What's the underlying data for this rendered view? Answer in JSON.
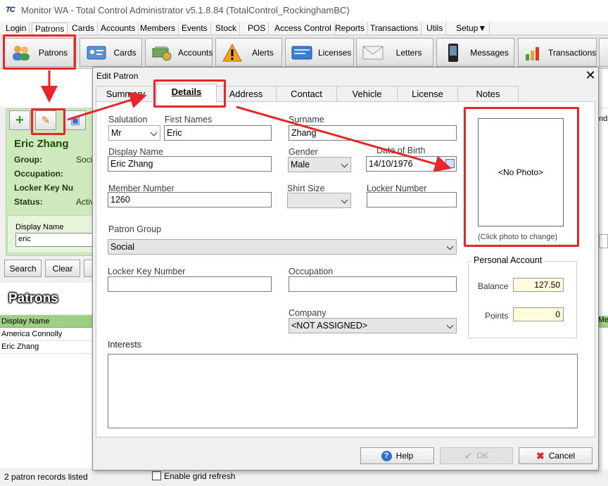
{
  "window": {
    "logo": "TC",
    "title": "Monitor WA - Total Control Administrator v5.1.8.84 (TotalControl_RockinghamBC)"
  },
  "menu": [
    "Login",
    "Patrons",
    "Cards",
    "Accounts",
    "Members",
    "Events",
    "Stock",
    "POS",
    "Access Control",
    "Reports",
    "Transactions",
    "Utils",
    "Setup"
  ],
  "toolbar": [
    {
      "label": "Patrons",
      "icon": "people-icon"
    },
    {
      "label": "Cards",
      "icon": "id-card-icon"
    },
    {
      "label": "Accounts",
      "icon": "money-icon"
    },
    {
      "label": "Alerts",
      "icon": "warning-icon"
    },
    {
      "label": "Licenses",
      "icon": "license-icon"
    },
    {
      "label": "Letters",
      "icon": "envelope-icon"
    },
    {
      "label": "Messages",
      "icon": "phone-icon"
    },
    {
      "label": "Transactions",
      "icon": "bar-chart-icon"
    }
  ],
  "background": {
    "patron_name": "Eric Zhang",
    "fields": [
      {
        "label": "Group:",
        "value": "Soci"
      },
      {
        "label": "Occupation:",
        "value": ""
      },
      {
        "label": "Locker Key Nu",
        "value": ""
      },
      {
        "label": "Status:",
        "value": "Activ"
      }
    ],
    "display_name_label": "Display Name",
    "display_name_value": "eric",
    "search_label": "Search",
    "clear_label": "Clear",
    "patrons_title": "Patrons",
    "grid_header": "Display Name",
    "rows": [
      "America Connolly",
      "Eric Zhang"
    ],
    "right_fragment_1": "nds",
    "right_fragment_2": "Men",
    "status": "2 patron records listed",
    "refresh_label": "Enable grid refresh"
  },
  "dialog": {
    "title": "Edit Patron",
    "close": "✕",
    "tabs": [
      "Summary",
      "Details",
      "Address",
      "Contact",
      "Vehicle",
      "License",
      "Notes"
    ],
    "active_tab": "Details",
    "salutation": {
      "label": "Salutation",
      "value": "Mr"
    },
    "first_names": {
      "label": "First Names",
      "value": "Eric"
    },
    "surname": {
      "label": "Surname",
      "value": "Zhang"
    },
    "display_name": {
      "label": "Display Name",
      "value": "Eric Zhang"
    },
    "gender": {
      "label": "Gender",
      "value": "Male"
    },
    "dob": {
      "label": "Date of Birth",
      "value": "14/10/1976"
    },
    "member_number": {
      "label": "Member Number",
      "value": "1260"
    },
    "shirt_size": {
      "label": "Shirt Size",
      "value": ""
    },
    "locker_number": {
      "label": "Locker Number",
      "value": ""
    },
    "patron_group": {
      "label": "Patron Group",
      "value": "Social"
    },
    "locker_key_number": {
      "label": "Locker Key Number",
      "value": ""
    },
    "occupation": {
      "label": "Occupation",
      "value": ""
    },
    "company": {
      "label": "Company",
      "value": "<NOT ASSIGNED>"
    },
    "interests": {
      "label": "Interests",
      "value": ""
    },
    "photo": {
      "text": "<No Photo>",
      "hint": "(Click photo to change)"
    },
    "account": {
      "title": "Personal Account",
      "balance_label": "Balance",
      "balance": "127.50",
      "points_label": "Points",
      "points": "0"
    },
    "buttons": {
      "help": "Help",
      "ok": "OK",
      "cancel": "Cancel"
    }
  },
  "colors": {
    "annotation": "#e8262a",
    "accent_green": "#cfe9be"
  }
}
